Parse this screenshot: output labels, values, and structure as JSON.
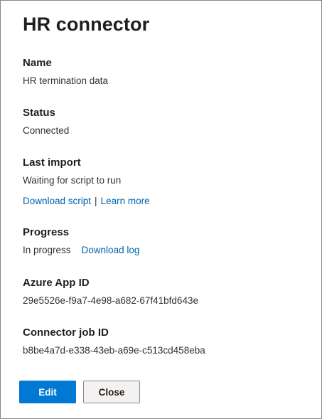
{
  "panel": {
    "title": "HR connector"
  },
  "name": {
    "label": "Name",
    "value": "HR termination data"
  },
  "status": {
    "label": "Status",
    "value": "Connected"
  },
  "last_import": {
    "label": "Last import",
    "value": "Waiting for script to run",
    "download_script": "Download script",
    "separator": "|",
    "learn_more": "Learn more"
  },
  "progress": {
    "label": "Progress",
    "value": "In progress",
    "download_log": "Download log"
  },
  "azure_app_id": {
    "label": "Azure App ID",
    "value": "29e5526e-f9a7-4e98-a682-67f41bfd643e"
  },
  "connector_job_id": {
    "label": "Connector job ID",
    "value": "b8be4a7d-e338-43eb-a69e-c513cd458eba"
  },
  "buttons": {
    "edit": "Edit",
    "close": "Close"
  },
  "colors": {
    "accent": "#0078d4",
    "link": "#0062ad"
  }
}
